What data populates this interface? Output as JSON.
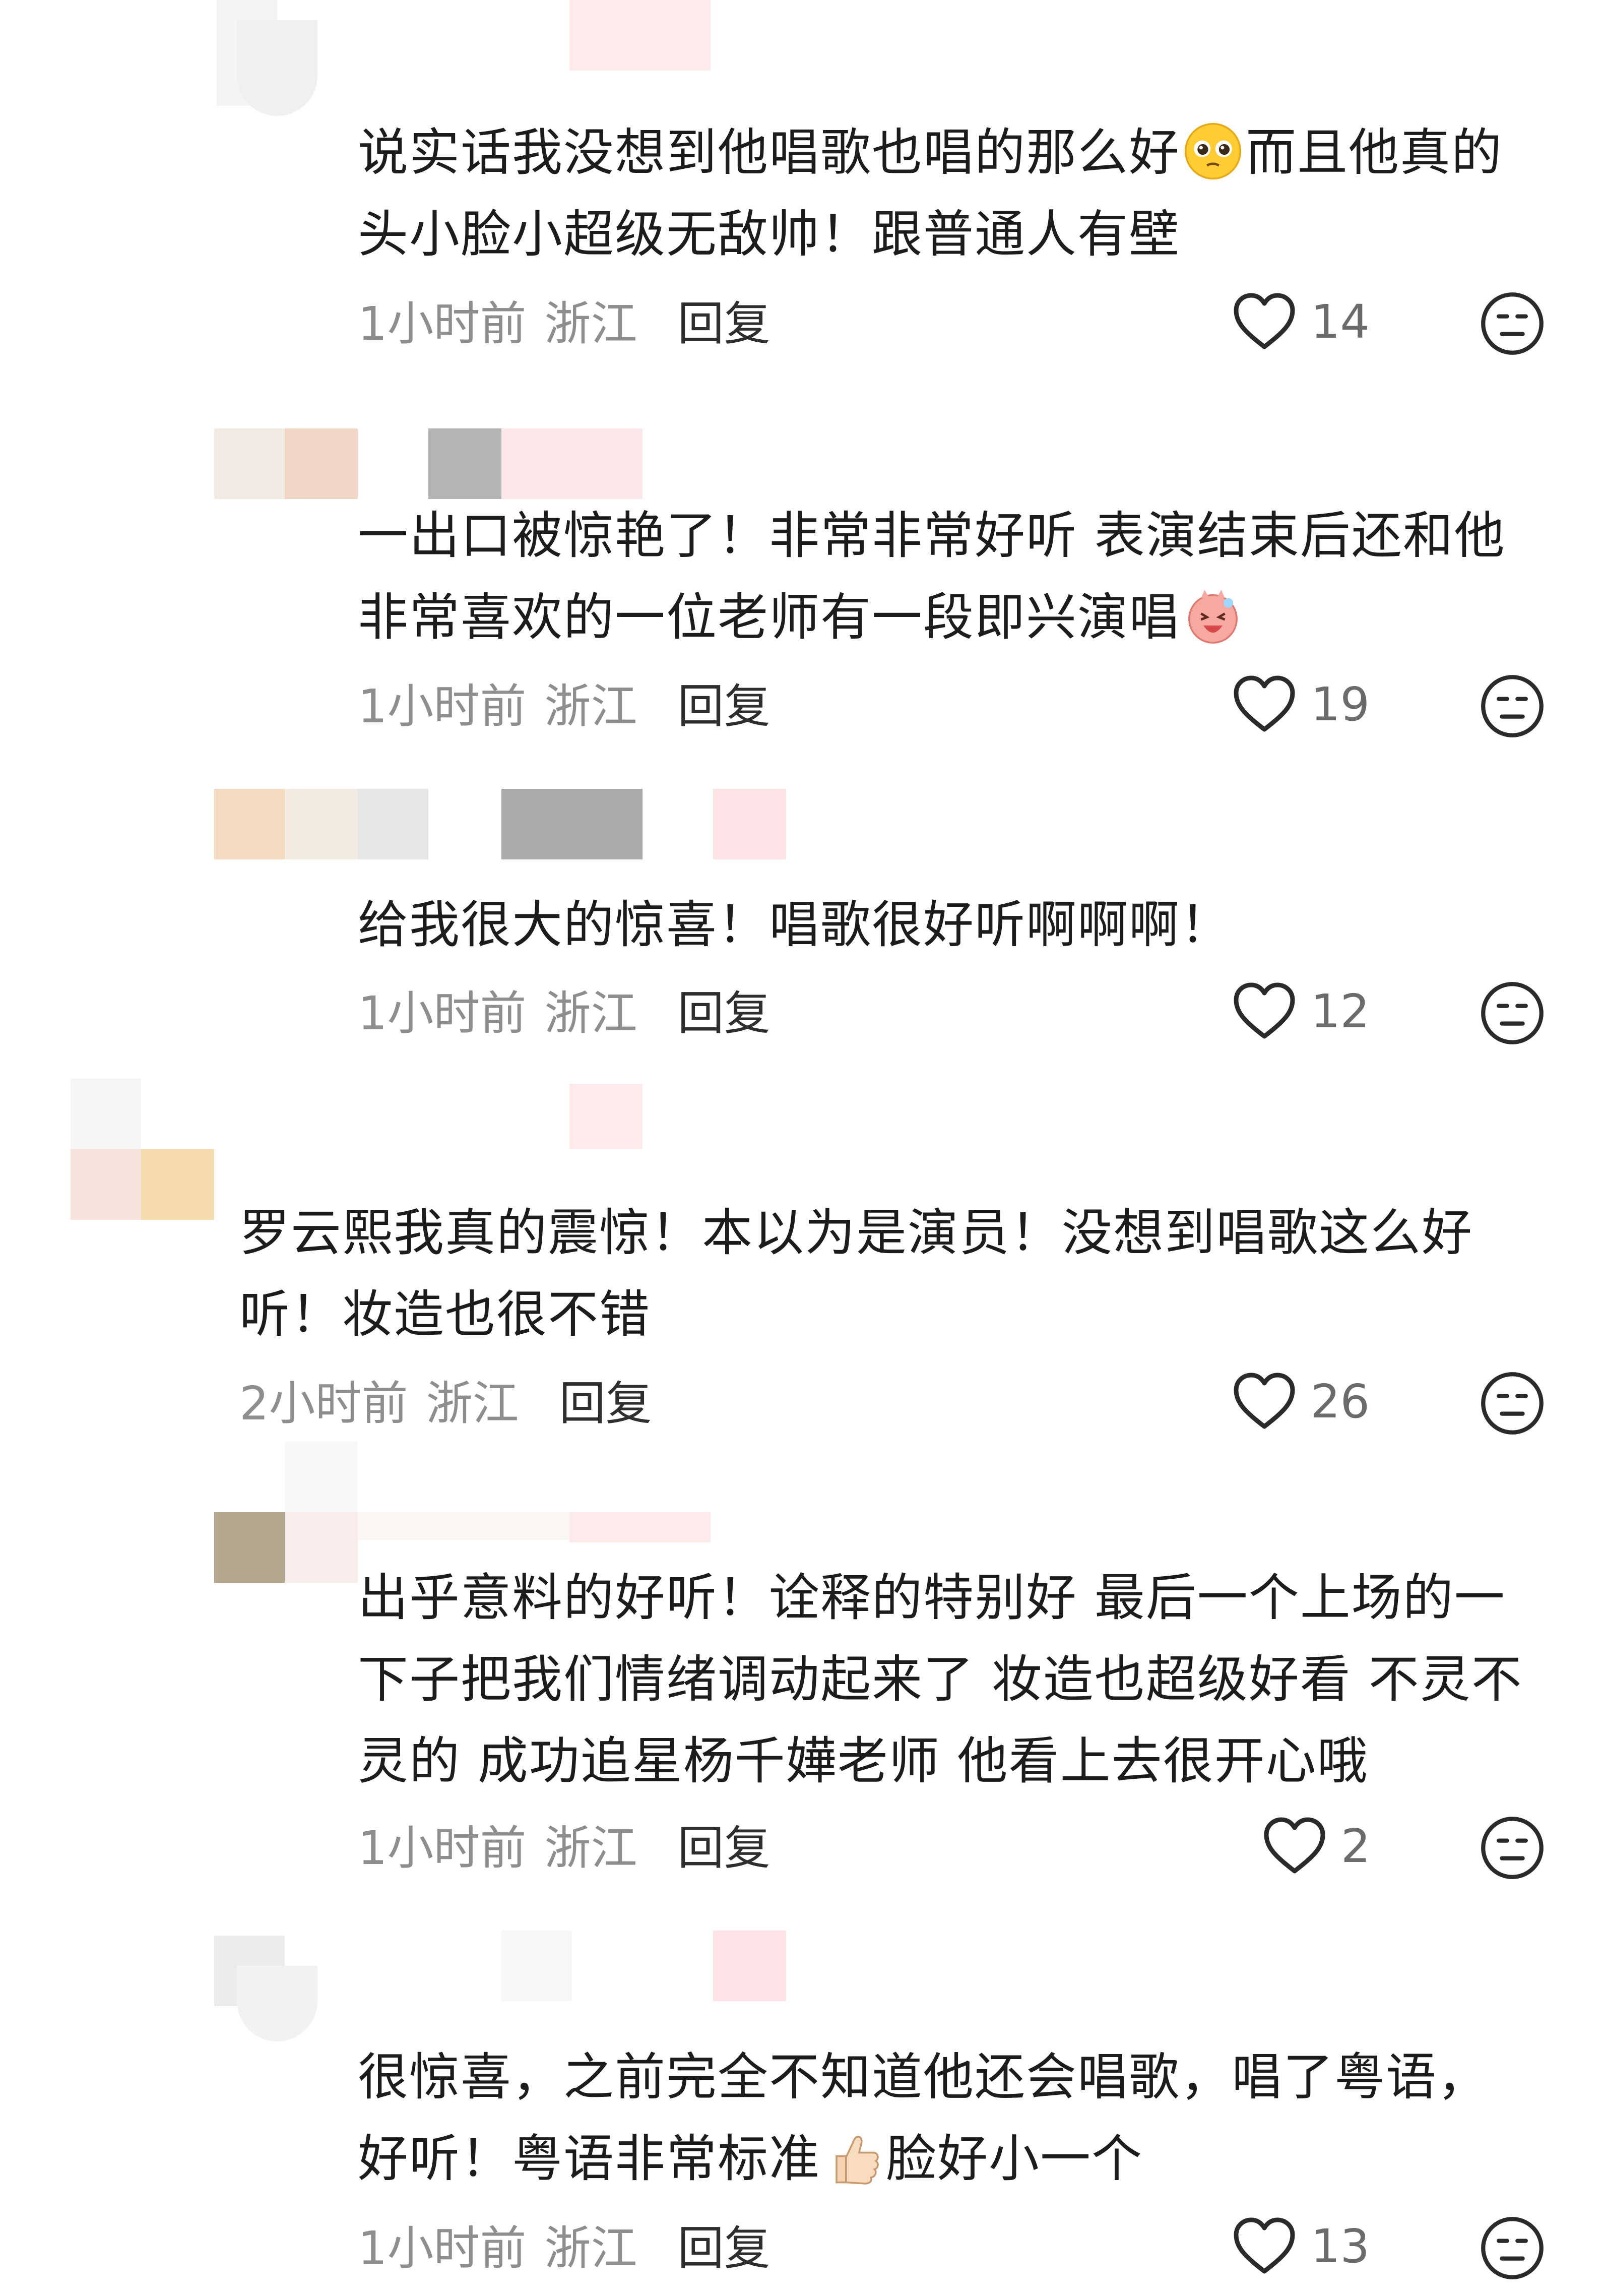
{
  "comments": [
    {
      "lines": [
        "说实话我没想到他唱歌也唱的那么好",
        "而且他真的",
        "头小脸小超级无敌帅！跟普通人有壁"
      ],
      "time": "1小时前",
      "location": "浙江",
      "reply": "回复",
      "likes": "14"
    },
    {
      "lines": [
        "一出口被惊艳了！非常非常好听 表演结束后还和他",
        "非常喜欢的一位老师有一段即兴演唱"
      ],
      "time": "1小时前",
      "location": "浙江",
      "reply": "回复",
      "likes": "19"
    },
    {
      "lines": [
        "给我很大的惊喜！唱歌很好听啊啊啊！"
      ],
      "time": "1小时前",
      "location": "浙江",
      "reply": "回复",
      "likes": "12"
    },
    {
      "lines": [
        "罗云熙我真的震惊！本以为是演员！没想到唱歌这么好",
        "听！妆造也很不错"
      ],
      "time": "2小时前",
      "location": "浙江",
      "reply": "回复",
      "likes": "26"
    },
    {
      "lines": [
        "出乎意料的好听！诠释的特别好 最后一个上场的一",
        "下子把我们情绪调动起来了 妆造也超级好看 不灵不",
        "灵的 成功追星杨千嬅老师 他看上去很开心哦"
      ],
      "time": "1小时前",
      "location": "浙江",
      "reply": "回复",
      "likes": "2"
    },
    {
      "lines": [
        "很惊喜，之前完全不知道他还会唱歌，唱了粤语，",
        "好听！粤语非常标准",
        "脸好小一个"
      ],
      "time": "1小时前",
      "location": "浙江",
      "reply": "回复",
      "likes": "13"
    }
  ],
  "icons": {
    "like": "heart-outline-icon",
    "reaction": "neutral-face-icon",
    "emoji_pleading": "pleading-face-emoji",
    "emoji_laugh": "laughing-pig-emoji",
    "emoji_thumb": "thumbs-up-emoji"
  },
  "colors": {
    "meta_text": "#8e8e8e",
    "reply_text": "#2e2e2e",
    "like_icon": "#2a2a2a"
  }
}
